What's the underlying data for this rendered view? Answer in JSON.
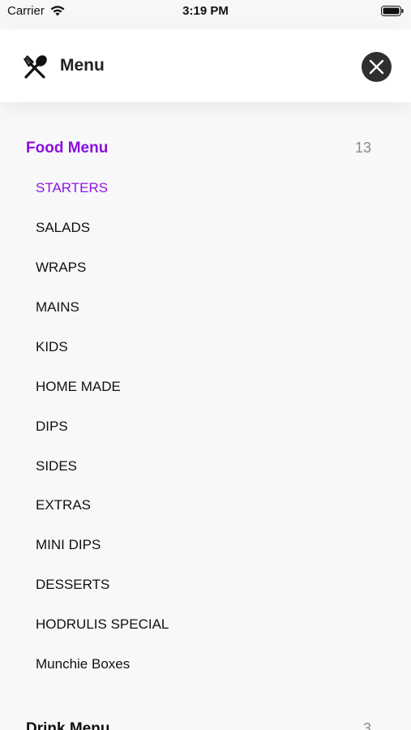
{
  "status_bar": {
    "carrier": "Carrier",
    "time": "3:19 PM"
  },
  "header": {
    "title": "Menu",
    "icon": "fork-spoon-icon",
    "close_icon": "close-icon"
  },
  "colors": {
    "accent": "#8f14e8",
    "close_bg": "#2f2f30",
    "count": "#8a8a8e"
  },
  "sections": [
    {
      "title": "Food Menu",
      "count": "13",
      "items": [
        {
          "label": "STARTERS",
          "active": true
        },
        {
          "label": "SALADS"
        },
        {
          "label": "WRAPS"
        },
        {
          "label": "MAINS"
        },
        {
          "label": "KIDS"
        },
        {
          "label": "HOME MADE"
        },
        {
          "label": "DIPS"
        },
        {
          "label": "SIDES"
        },
        {
          "label": "EXTRAS"
        },
        {
          "label": "MINI DIPS"
        },
        {
          "label": "DESSERTS"
        },
        {
          "label": "HODRULIS SPECIAL"
        },
        {
          "label": "Munchie Boxes"
        }
      ]
    },
    {
      "title": "Drink Menu",
      "count": "3"
    }
  ]
}
